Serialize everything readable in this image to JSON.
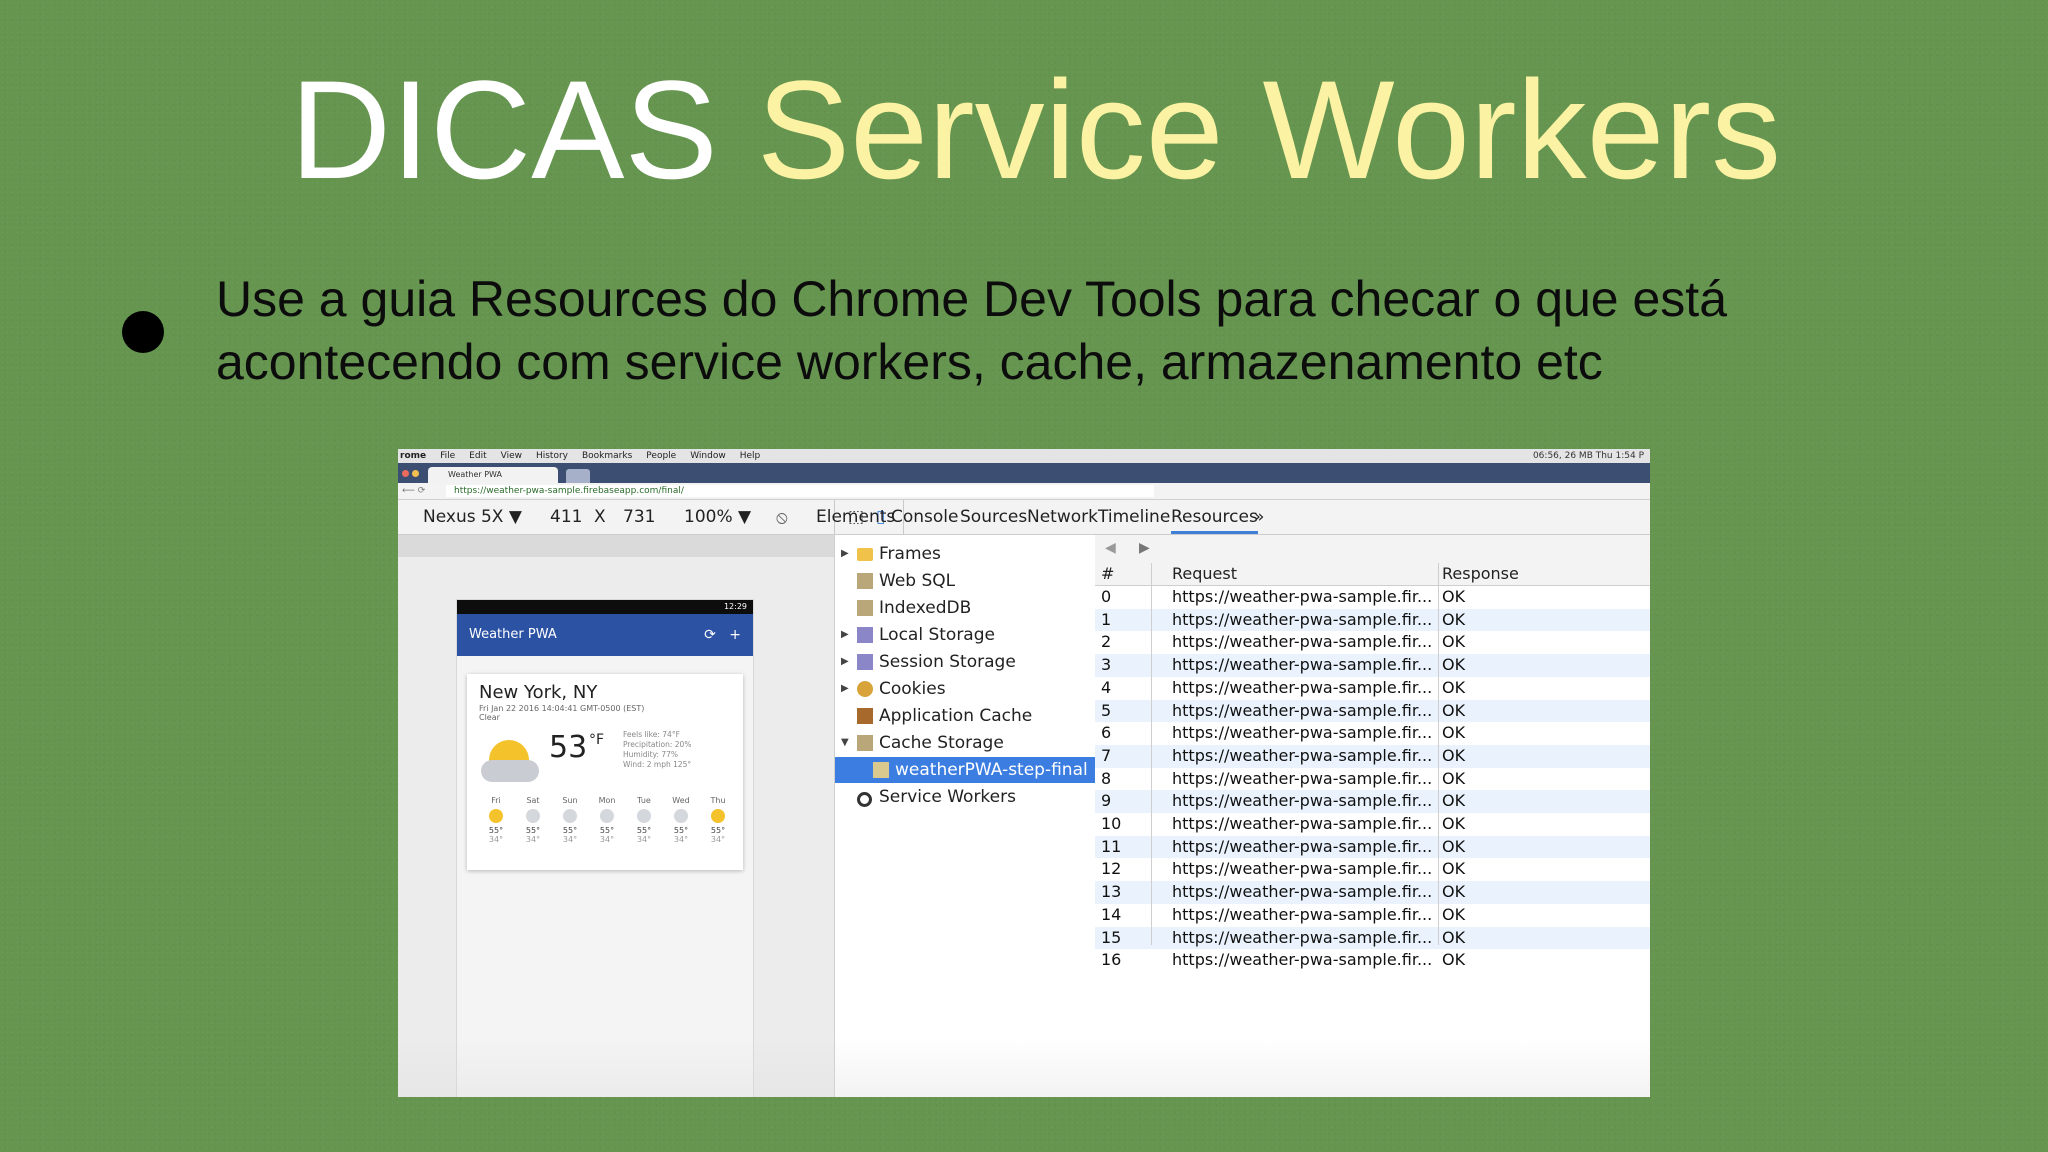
{
  "slide": {
    "title_plain": "DICAS",
    "title_accent": "Service Workers",
    "bullet": "Use a guia Resources do Chrome Dev Tools para checar o que está acontecendo com service workers, cache, armazenamento etc"
  },
  "menubar": {
    "items": [
      "rome",
      "File",
      "Edit",
      "View",
      "History",
      "Bookmarks",
      "People",
      "Window",
      "Help"
    ],
    "status": "06:56, 26 MB   Thu 1:54 P"
  },
  "browser": {
    "tab_title": "Weather PWA",
    "url": "https://weather-pwa-sample.firebaseapp.com/final/"
  },
  "device_toolbar": {
    "device": "Nexus 5X ▼",
    "width": "411",
    "times": "X",
    "height": "731",
    "zoom": "100% ▼"
  },
  "devtools": {
    "tabs": [
      "Elements",
      "Console",
      "Sources",
      "Network",
      "Timeline",
      "Resources"
    ],
    "active_tab": "Resources",
    "more": "»"
  },
  "app": {
    "status_time": "12:29",
    "appbar_title": "Weather PWA",
    "city": "New York, NY",
    "date": "Fri Jan 22 2016 14:04:41 GMT-0500 (EST)",
    "description": "Clear",
    "temp": "53",
    "unit": "°F",
    "details": [
      "Feels like: 74°F",
      "Precipitation: 20%",
      "Humidity: 77%",
      "Wind: 2 mph 125°"
    ],
    "forecast": [
      {
        "day": "Fri",
        "hi": "55°",
        "lo": "34°"
      },
      {
        "day": "Sat",
        "hi": "55°",
        "lo": "34°"
      },
      {
        "day": "Sun",
        "hi": "55°",
        "lo": "34°"
      },
      {
        "day": "Mon",
        "hi": "55°",
        "lo": "34°"
      },
      {
        "day": "Tue",
        "hi": "55°",
        "lo": "34°"
      },
      {
        "day": "Wed",
        "hi": "55°",
        "lo": "34°"
      },
      {
        "day": "Thu",
        "hi": "55°",
        "lo": "34°"
      }
    ]
  },
  "resources_tree": [
    {
      "label": "Frames",
      "arrow": "▶",
      "icon": "folder-icon",
      "color": "#f0c24a"
    },
    {
      "label": "Web SQL",
      "arrow": "",
      "icon": "database-icon",
      "color": "#b9a77a"
    },
    {
      "label": "IndexedDB",
      "arrow": "",
      "icon": "database-icon",
      "color": "#b9a77a"
    },
    {
      "label": "Local Storage",
      "arrow": "▶",
      "icon": "storage-icon",
      "color": "#8a86c8"
    },
    {
      "label": "Session Storage",
      "arrow": "▶",
      "icon": "storage-icon",
      "color": "#8a86c8"
    },
    {
      "label": "Cookies",
      "arrow": "▶",
      "icon": "cookie-icon",
      "color": "#d8a43a"
    },
    {
      "label": "Application Cache",
      "arrow": "",
      "icon": "app-cache-icon",
      "color": "#a86a2c"
    },
    {
      "label": "Cache Storage",
      "arrow": "▼",
      "icon": "database-icon",
      "color": "#b9a77a"
    },
    {
      "label": "weatherPWA-step-final",
      "arrow": "",
      "icon": "database-icon",
      "color": "#d9c98e",
      "selected": true
    },
    {
      "label": "Service Workers",
      "arrow": "",
      "icon": "gear-icon",
      "color": "#333333"
    }
  ],
  "cache_table": {
    "headers": [
      "#",
      "Request",
      "Response"
    ],
    "rows": [
      {
        "n": "0",
        "request": "https://weather-pwa-sample.fir...",
        "response": "OK"
      },
      {
        "n": "1",
        "request": "https://weather-pwa-sample.fir...",
        "response": "OK"
      },
      {
        "n": "2",
        "request": "https://weather-pwa-sample.fir...",
        "response": "OK"
      },
      {
        "n": "3",
        "request": "https://weather-pwa-sample.fir...",
        "response": "OK"
      },
      {
        "n": "4",
        "request": "https://weather-pwa-sample.fir...",
        "response": "OK"
      },
      {
        "n": "5",
        "request": "https://weather-pwa-sample.fir...",
        "response": "OK"
      },
      {
        "n": "6",
        "request": "https://weather-pwa-sample.fir...",
        "response": "OK"
      },
      {
        "n": "7",
        "request": "https://weather-pwa-sample.fir...",
        "response": "OK"
      },
      {
        "n": "8",
        "request": "https://weather-pwa-sample.fir...",
        "response": "OK"
      },
      {
        "n": "9",
        "request": "https://weather-pwa-sample.fir...",
        "response": "OK"
      },
      {
        "n": "10",
        "request": "https://weather-pwa-sample.fir...",
        "response": "OK"
      },
      {
        "n": "11",
        "request": "https://weather-pwa-sample.fir...",
        "response": "OK"
      },
      {
        "n": "12",
        "request": "https://weather-pwa-sample.fir...",
        "response": "OK"
      },
      {
        "n": "13",
        "request": "https://weather-pwa-sample.fir...",
        "response": "OK"
      },
      {
        "n": "14",
        "request": "https://weather-pwa-sample.fir...",
        "response": "OK"
      },
      {
        "n": "15",
        "request": "https://weather-pwa-sample.fir...",
        "response": "OK"
      },
      {
        "n": "16",
        "request": "https://weather-pwa-sample.fir...",
        "response": "OK"
      }
    ]
  },
  "colors": {
    "slide_bg": "#669550",
    "title_accent": "#fbf3a3",
    "tab_strip": "#3c4f73",
    "app_bar": "#2c52a3",
    "selection": "#3b7de0"
  }
}
